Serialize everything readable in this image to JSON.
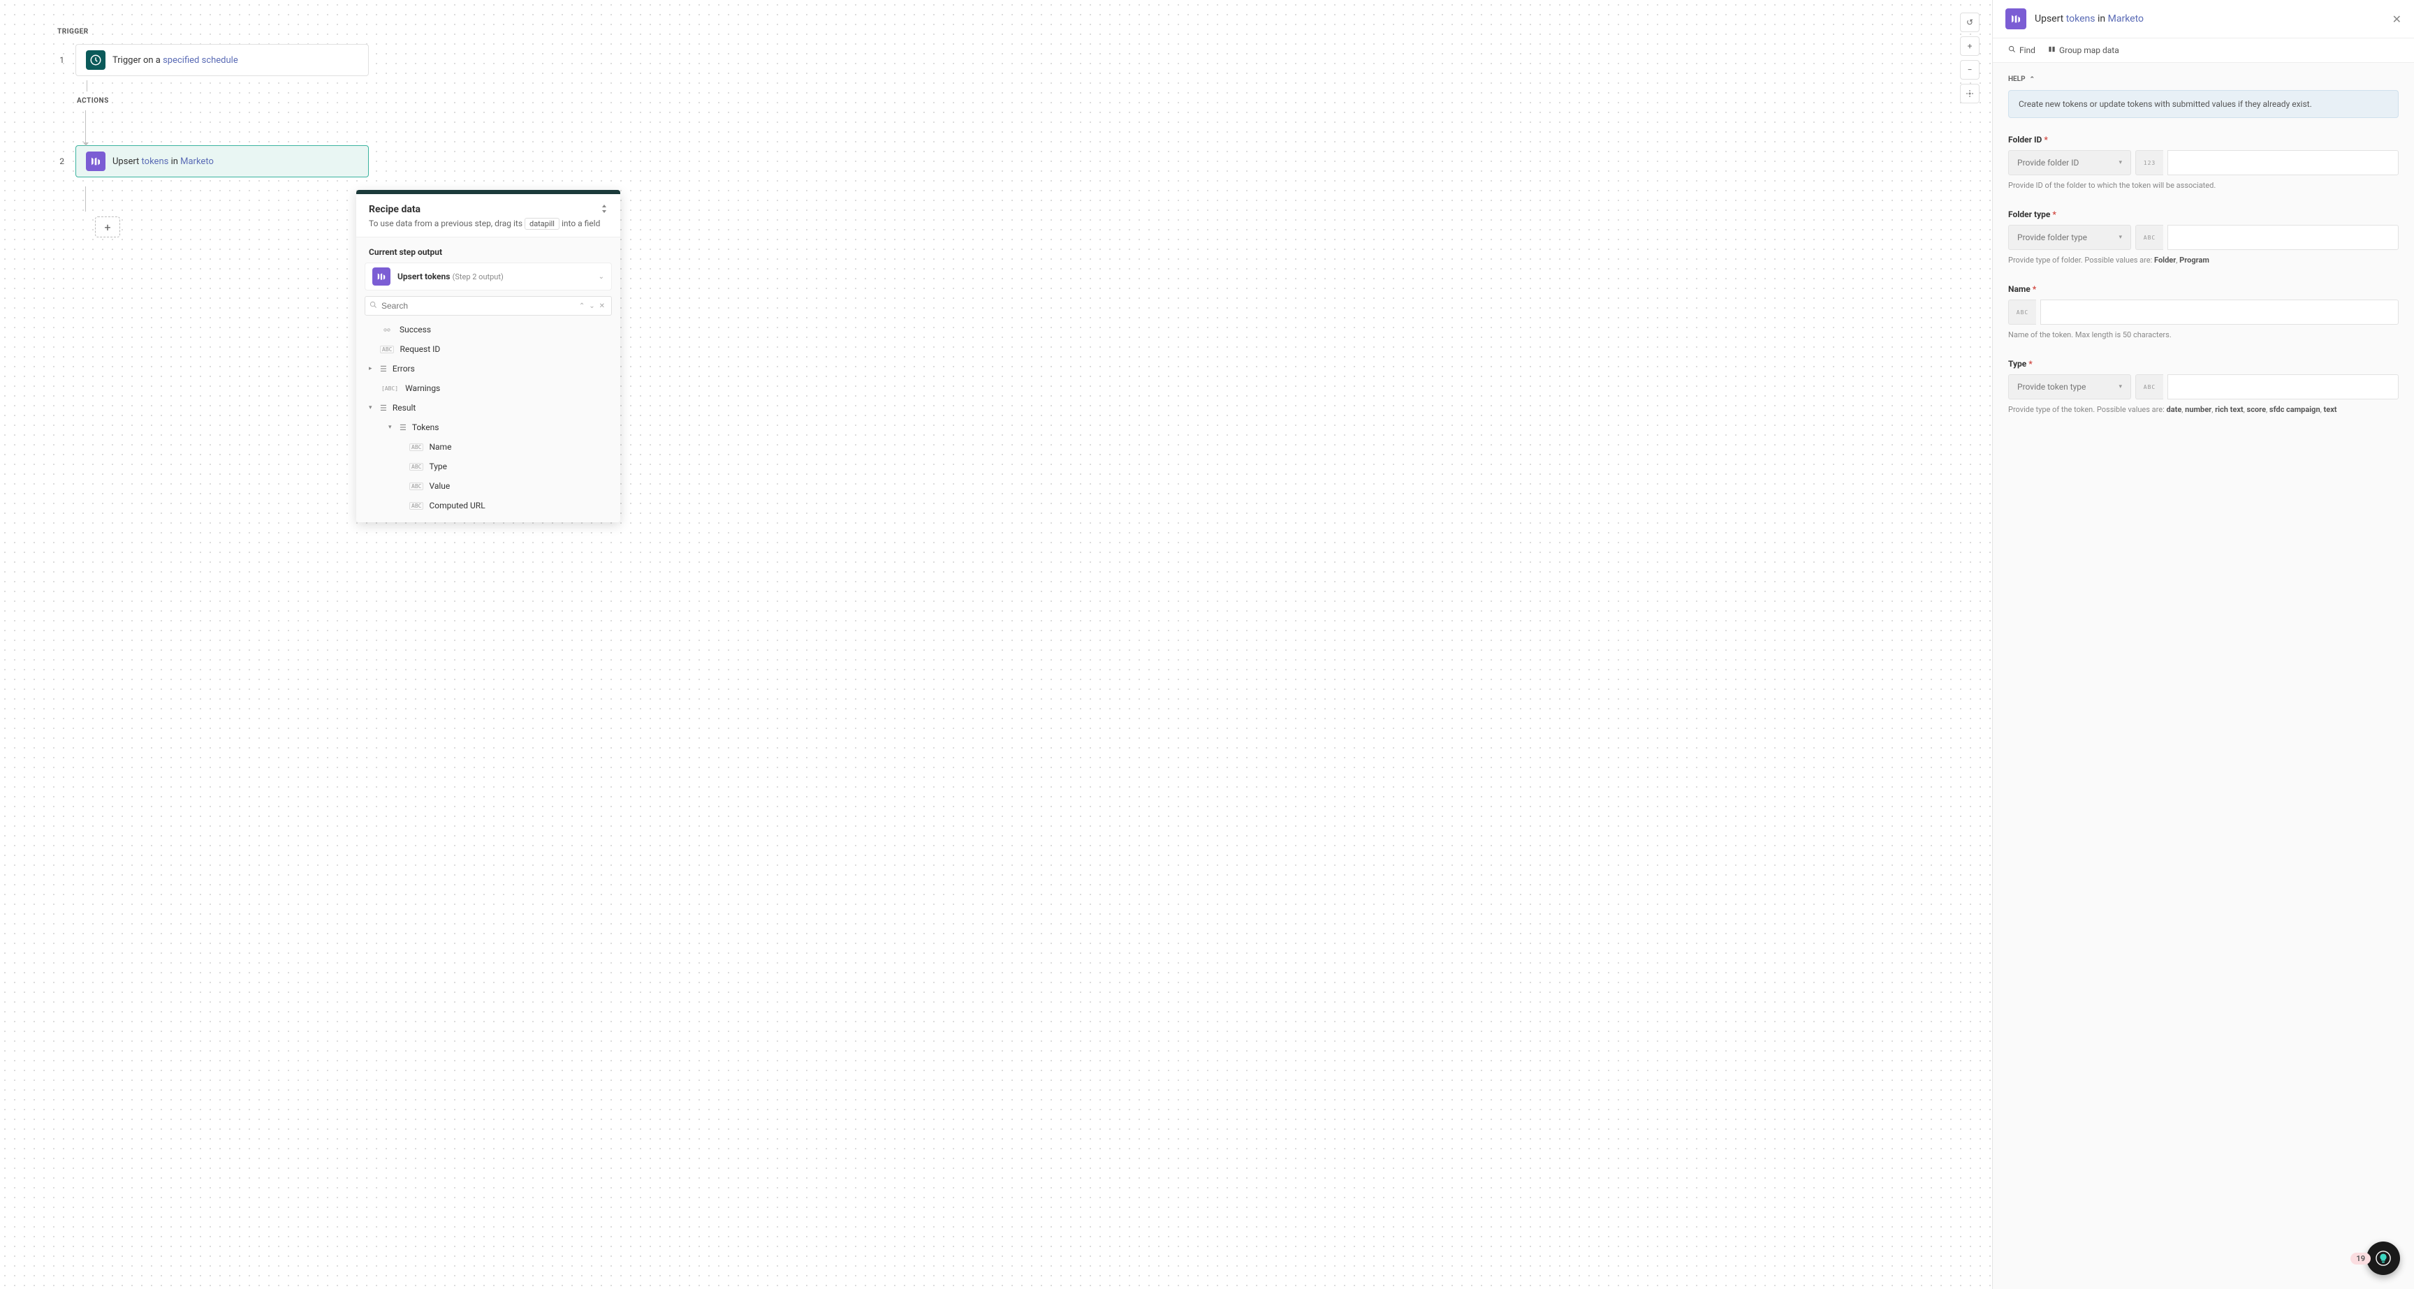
{
  "canvas": {
    "trigger_label": "TRIGGER",
    "actions_label": "ACTIONS",
    "steps": [
      {
        "num": "1",
        "prefix": "Trigger on a ",
        "link": "specified schedule",
        "app": "clock"
      },
      {
        "num": "2",
        "prefix": "Upsert ",
        "link1": "tokens",
        "mid": " in ",
        "link2": "Marketo",
        "app": "marketo"
      }
    ]
  },
  "canvas_tools": {
    "undo": "↺",
    "zoom_in": "+",
    "zoom_out": "−",
    "fit": "⛶"
  },
  "recipe_panel": {
    "title": "Recipe data",
    "subtitle_pre": "To use data from a previous step, drag its ",
    "datapill": "datapill",
    "subtitle_post": " into a field",
    "current_step_label": "Current step output",
    "output_title": "Upsert tokens",
    "output_sub": "(Step 2 output)",
    "search_placeholder": "Search",
    "tree": [
      {
        "indent": 1,
        "type": "bool",
        "label": "Success",
        "badge": "⊙⊘"
      },
      {
        "indent": 1,
        "type": "abc",
        "label": "Request ID",
        "badge": "ABC"
      },
      {
        "indent": 1,
        "type": "list",
        "label": "Errors",
        "caret": "▸"
      },
      {
        "indent": 1,
        "type": "abc-bracket",
        "label": "Warnings",
        "badge": "[ABC]"
      },
      {
        "indent": 1,
        "type": "list",
        "label": "Result",
        "caret": "▾"
      },
      {
        "indent": 2,
        "type": "list",
        "label": "Tokens",
        "caret": "▾"
      },
      {
        "indent": 3,
        "type": "abc",
        "label": "Name",
        "badge": "ABC"
      },
      {
        "indent": 3,
        "type": "abc",
        "label": "Type",
        "badge": "ABC"
      },
      {
        "indent": 3,
        "type": "abc",
        "label": "Value",
        "badge": "ABC"
      },
      {
        "indent": 3,
        "type": "abc",
        "label": "Computed URL",
        "badge": "ABC"
      }
    ]
  },
  "config": {
    "title_prefix": "Upsert ",
    "title_link1": "tokens",
    "title_mid": " in ",
    "title_link2": "Marketo",
    "toolbar": {
      "find": "Find",
      "group": "Group map data"
    },
    "help_label": "HELP",
    "help_text": "Create new tokens or update tokens with submitted values if they already exist.",
    "fields": {
      "folder_id": {
        "label": "Folder ID",
        "select": "Provide folder ID",
        "prefix": "123",
        "hint": "Provide ID of the folder to which the token will be associated."
      },
      "folder_type": {
        "label": "Folder type",
        "select": "Provide folder type",
        "prefix": "ABC",
        "hint_pre": "Provide type of folder. Possible values are: ",
        "hint_b1": "Folder",
        "hint_sep": ", ",
        "hint_b2": "Program"
      },
      "name": {
        "label": "Name",
        "prefix": "ABC",
        "hint": "Name of the token. Max length is 50 characters."
      },
      "type": {
        "label": "Type",
        "select": "Provide token type",
        "prefix": "ABC",
        "hint_pre": "Provide type of the token. Possible values are: ",
        "values": [
          "date",
          "number",
          "rich text",
          "score",
          "sfdc campaign",
          "text"
        ]
      }
    }
  },
  "fab": {
    "count": "19"
  }
}
